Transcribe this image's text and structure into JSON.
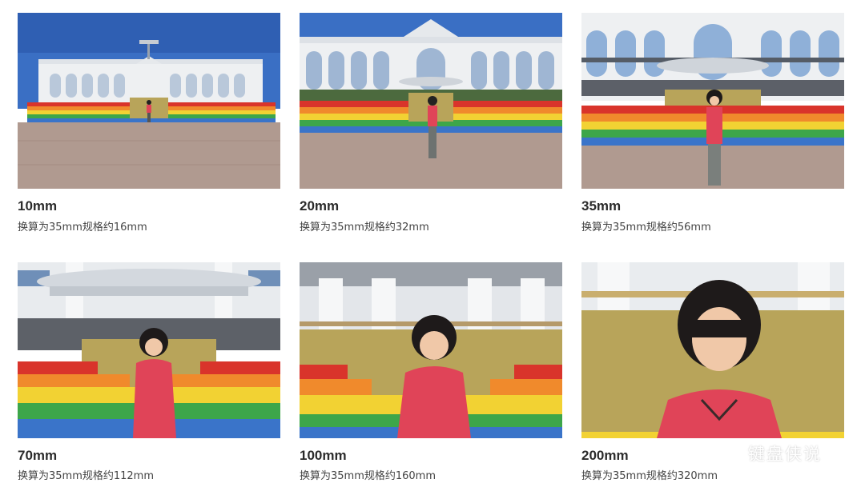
{
  "photos": [
    {
      "focal": "10mm",
      "equiv": "换算为35mm规格约16mm"
    },
    {
      "focal": "20mm",
      "equiv": "换算为35mm规格约32mm"
    },
    {
      "focal": "35mm",
      "equiv": "换算为35mm规格约56mm"
    },
    {
      "focal": "70mm",
      "equiv": "换算为35mm规格约112mm"
    },
    {
      "focal": "100mm",
      "equiv": "换算为35mm规格约160mm"
    },
    {
      "focal": "200mm",
      "equiv": "换算为35mm规格约320mm"
    }
  ],
  "watermark": {
    "text": "键盘侠说",
    "icon": "wechat-icon"
  },
  "colors": {
    "sky": "#3a6fc4",
    "pavement": "#b09a90",
    "building": "#eef0f2",
    "rainbow": [
      "#d9342b",
      "#f08a2c",
      "#f2d233",
      "#3da64a",
      "#3a74c9"
    ],
    "gold": "#b8a45a",
    "shirt": "#e04458"
  }
}
